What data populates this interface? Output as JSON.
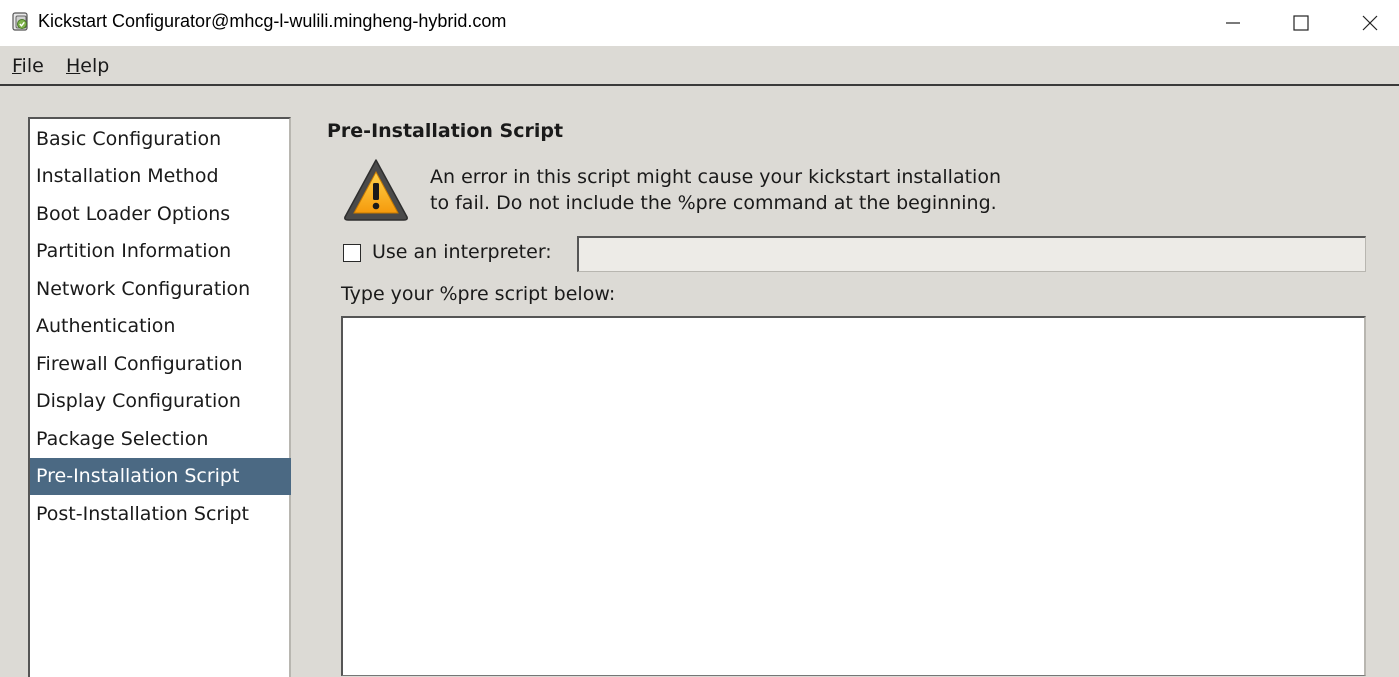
{
  "window": {
    "title": "Kickstart Configurator@mhcg-l-wulili.mingheng-hybrid.com",
    "icons": {
      "app": "kickstart-app-icon",
      "minimize": "minimize-icon",
      "maximize": "maximize-icon",
      "close": "close-icon"
    }
  },
  "menubar": {
    "file": {
      "mnemonic": "F",
      "rest": "ile"
    },
    "help": {
      "mnemonic": "H",
      "rest": "elp"
    }
  },
  "sidebar": {
    "selected_index": 9,
    "selected_color": "#4b6983",
    "items": [
      {
        "label": "Basic Configuration"
      },
      {
        "label": "Installation Method"
      },
      {
        "label": "Boot Loader Options"
      },
      {
        "label": "Partition Information"
      },
      {
        "label": "Network Configuration"
      },
      {
        "label": "Authentication"
      },
      {
        "label": "Firewall Configuration"
      },
      {
        "label": "Display Configuration"
      },
      {
        "label": "Package Selection"
      },
      {
        "label": "Pre-Installation Script"
      },
      {
        "label": "Post-Installation Script"
      }
    ]
  },
  "main": {
    "title": "Pre-Installation Script",
    "warning": {
      "icon": "warning-icon",
      "line1": "An error in this script might cause your kickstart installation",
      "line2": "to fail. Do not include the %pre command at the beginning."
    },
    "interpreter": {
      "label": "Use an interpreter:",
      "checked": false,
      "value": ""
    },
    "script": {
      "label": "Type your %pre script below:",
      "value": ""
    }
  }
}
